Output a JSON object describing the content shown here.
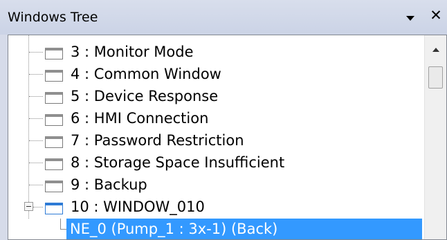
{
  "panel": {
    "title": "Windows Tree",
    "dropdown_icon": "dropdown-triangle-icon",
    "close_icon": "close-icon"
  },
  "tree": {
    "items": [
      {
        "label": "3 : Monitor Mode"
      },
      {
        "label": "4 : Common Window"
      },
      {
        "label": "5 : Device Response"
      },
      {
        "label": "6 : HMI Connection"
      },
      {
        "label": "7 : Password Restriction"
      },
      {
        "label": "8 : Storage Space Insufficient"
      },
      {
        "label": "9 : Backup"
      },
      {
        "label": "10 : WINDOW_010",
        "expanded": true,
        "active": true
      }
    ],
    "child": {
      "label": "NE_0 (Pump_1 : 3x-1) (Back)",
      "selected": true
    }
  },
  "colors": {
    "selection": "#3399ff",
    "title_bar": "#d0d7e8",
    "active_window_icon": "#2e7bd6"
  }
}
